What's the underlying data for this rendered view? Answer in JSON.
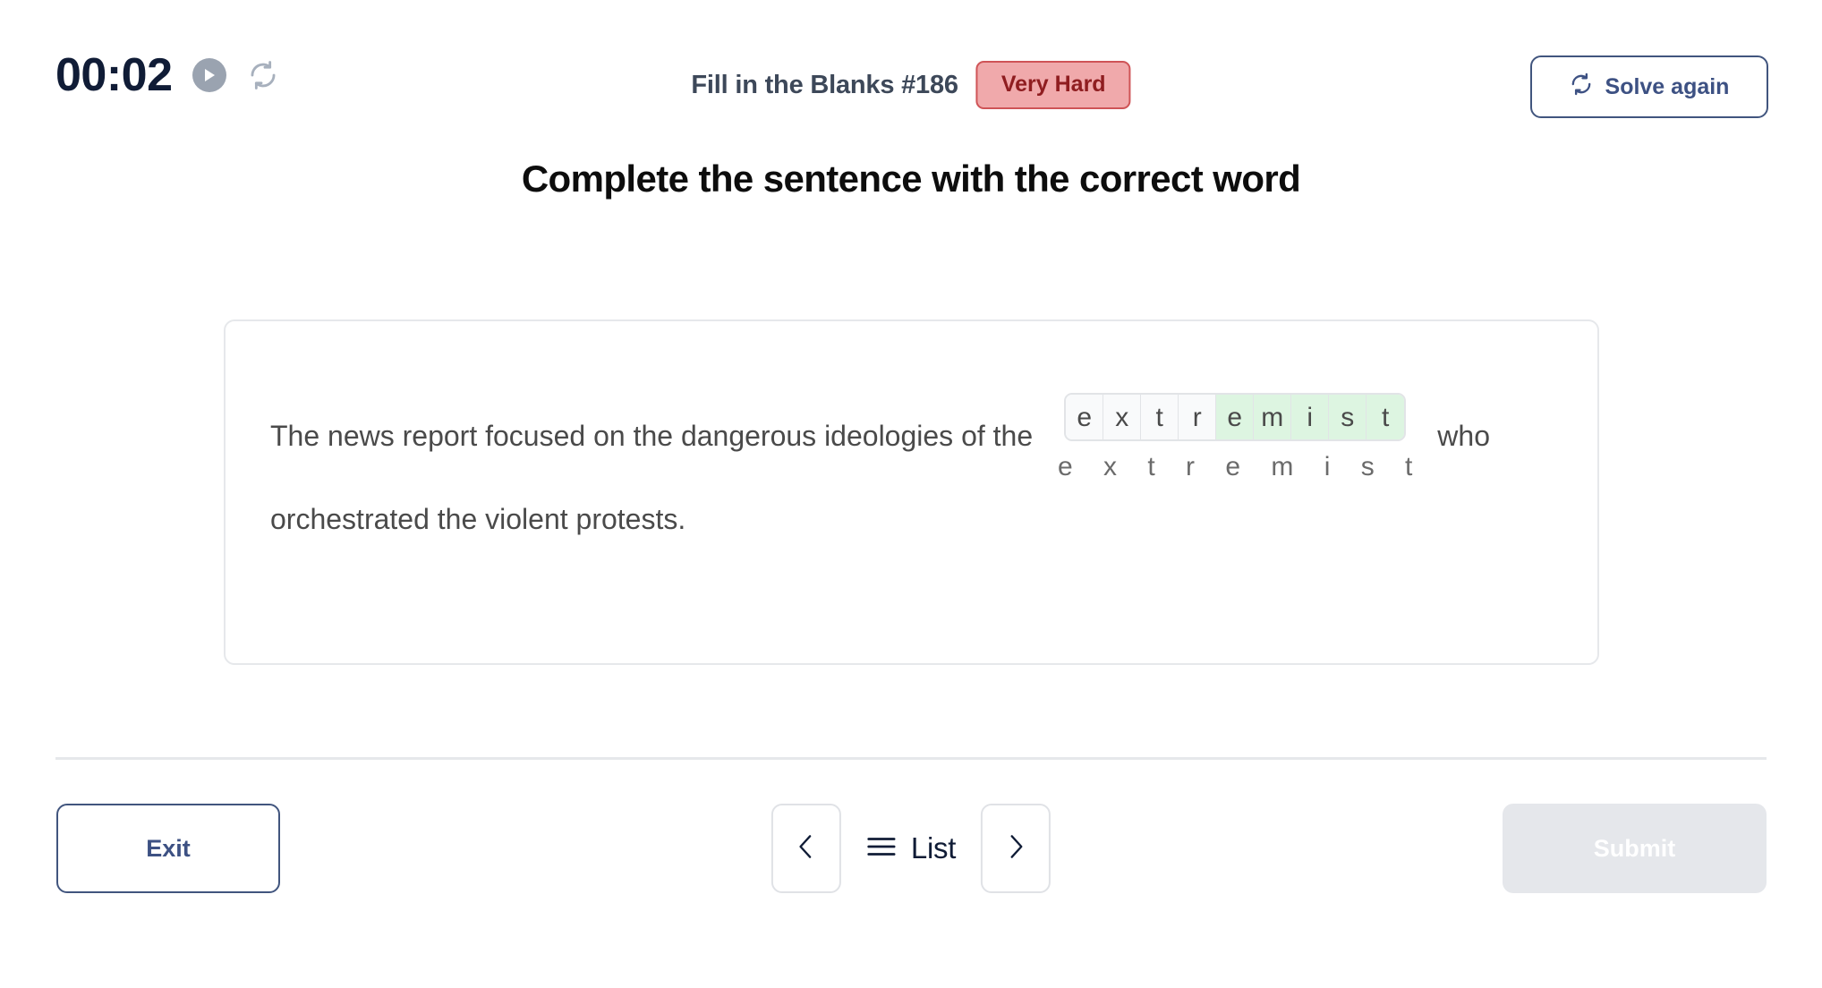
{
  "header": {
    "timer": "00:02",
    "play_icon": "play-icon",
    "reset_icon": "reset-icon",
    "quiz_title": "Fill in the Blanks #186",
    "difficulty": "Very Hard",
    "solve_again_label": "Solve again",
    "solve_again_icon": "refresh-icon"
  },
  "heading": "Complete the sentence with the correct word",
  "question": {
    "text_before": "The news report focused on the dangerous ideologies of the",
    "text_after": "who",
    "second_line": "orchestrated the violent protests.",
    "answer_word": "extremist",
    "letters": [
      {
        "char": "e",
        "filled": false
      },
      {
        "char": "x",
        "filled": false
      },
      {
        "char": "t",
        "filled": false
      },
      {
        "char": "r",
        "filled": false
      },
      {
        "char": "e",
        "filled": true
      },
      {
        "char": "m",
        "filled": true
      },
      {
        "char": "i",
        "filled": true
      },
      {
        "char": "s",
        "filled": true
      },
      {
        "char": "t",
        "filled": true
      }
    ],
    "hint": "e x t r e m i s t"
  },
  "footer": {
    "exit_label": "Exit",
    "prev_icon": "chevron-left-icon",
    "list_label": "List",
    "list_icon": "hamburger-icon",
    "next_icon": "chevron-right-icon",
    "submit_label": "Submit"
  },
  "colors": {
    "navy": "#101c36",
    "button_blue": "#3d5183",
    "badge_bg": "#f0a9ab",
    "badge_border": "#cf5457",
    "badge_text": "#8f1d20",
    "filled_cell": "#ddf5e1",
    "empty_cell": "#f9fafb",
    "border_light": "#e6e8eb",
    "submit_disabled_bg": "#e5e7eb"
  }
}
